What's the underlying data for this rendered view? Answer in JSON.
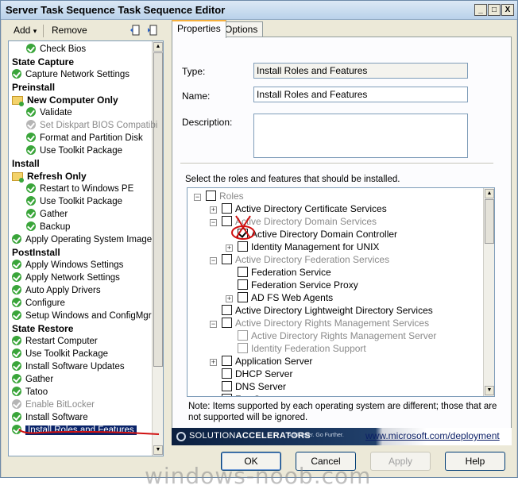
{
  "window": {
    "title": "Server Task Sequence Task Sequence Editor",
    "min": "_",
    "max": "□",
    "close": "X"
  },
  "toolbar": {
    "add_label": "Add",
    "add_caret": "▾",
    "remove_label": "Remove"
  },
  "steps": [
    {
      "label": "Check Bios",
      "kind": "step",
      "indent": 1
    },
    {
      "label": "State Capture",
      "kind": "group",
      "indent": 0
    },
    {
      "label": "Capture Network Settings",
      "kind": "step",
      "indent": 0
    },
    {
      "label": "Preinstall",
      "kind": "group",
      "indent": 0
    },
    {
      "label": "New Computer Only",
      "kind": "folder",
      "indent": 0
    },
    {
      "label": "Validate",
      "kind": "step",
      "indent": 1
    },
    {
      "label": "Set Diskpart BIOS Compatibi",
      "kind": "disabled",
      "indent": 1
    },
    {
      "label": "Format and Partition Disk",
      "kind": "step",
      "indent": 1
    },
    {
      "label": "Use Toolkit Package",
      "kind": "step",
      "indent": 1
    },
    {
      "label": "Install",
      "kind": "group",
      "indent": 0
    },
    {
      "label": "Refresh Only",
      "kind": "folder",
      "indent": 0
    },
    {
      "label": "Restart to Windows PE",
      "kind": "step",
      "indent": 1
    },
    {
      "label": "Use Toolkit Package",
      "kind": "step",
      "indent": 1
    },
    {
      "label": "Gather",
      "kind": "step",
      "indent": 1
    },
    {
      "label": "Backup",
      "kind": "step",
      "indent": 1
    },
    {
      "label": "Apply Operating System Image",
      "kind": "step",
      "indent": 0
    },
    {
      "label": "PostInstall",
      "kind": "group",
      "indent": 0
    },
    {
      "label": "Apply Windows Settings",
      "kind": "step",
      "indent": 0
    },
    {
      "label": "Apply Network Settings",
      "kind": "step",
      "indent": 0
    },
    {
      "label": "Auto Apply Drivers",
      "kind": "step",
      "indent": 0
    },
    {
      "label": "Configure",
      "kind": "step",
      "indent": 0
    },
    {
      "label": "Setup Windows and ConfigMgr",
      "kind": "step",
      "indent": 0
    },
    {
      "label": "State Restore",
      "kind": "group",
      "indent": 0
    },
    {
      "label": "Restart Computer",
      "kind": "step",
      "indent": 0
    },
    {
      "label": "Use Toolkit Package",
      "kind": "step",
      "indent": 0
    },
    {
      "label": "Install Software Updates",
      "kind": "step",
      "indent": 0
    },
    {
      "label": "Gather",
      "kind": "step",
      "indent": 0
    },
    {
      "label": "Tatoo",
      "kind": "step",
      "indent": 0
    },
    {
      "label": "Enable BitLocker",
      "kind": "disabled",
      "indent": 0
    },
    {
      "label": "Install Software",
      "kind": "step",
      "indent": 0
    },
    {
      "label": "Install Roles and Features",
      "kind": "selected",
      "indent": 0
    }
  ],
  "tabs": {
    "properties": "Properties",
    "options": "Options"
  },
  "form": {
    "type_label": "Type:",
    "type_value": "Install Roles and Features",
    "name_label": "Name:",
    "name_value": "Install Roles and Features",
    "description_label": "Description:",
    "description_value": "",
    "roles_prompt": "Select the roles and features that should be installed."
  },
  "roles": [
    {
      "label": "Roles",
      "level": 0,
      "expander": "−",
      "checked": false,
      "gray": true
    },
    {
      "label": "Active Directory Certificate Services",
      "level": 1,
      "expander": "+",
      "checked": false,
      "gray": false
    },
    {
      "label": "Active Directory Domain Services",
      "level": 1,
      "expander": "−",
      "checked": false,
      "gray": true
    },
    {
      "label": "Active Directory Domain Controller",
      "level": 2,
      "expander": "",
      "checked": true,
      "gray": false
    },
    {
      "label": "Identity Management for UNIX",
      "level": 2,
      "expander": "+",
      "checked": false,
      "gray": false
    },
    {
      "label": "Active Directory Federation Services",
      "level": 1,
      "expander": "−",
      "checked": false,
      "gray": true
    },
    {
      "label": "Federation Service",
      "level": 2,
      "expander": "",
      "checked": false,
      "gray": false
    },
    {
      "label": "Federation Service Proxy",
      "level": 2,
      "expander": "",
      "checked": false,
      "gray": false
    },
    {
      "label": "AD FS Web Agents",
      "level": 2,
      "expander": "+",
      "checked": false,
      "gray": false
    },
    {
      "label": "Active Directory Lightweight Directory Services",
      "level": 1,
      "expander": "",
      "checked": false,
      "gray": false
    },
    {
      "label": "Active Directory Rights Management Services",
      "level": 1,
      "expander": "−",
      "checked": false,
      "gray": true
    },
    {
      "label": "Active Directory Rights Management Server",
      "level": 2,
      "expander": "",
      "checked": false,
      "gray": true
    },
    {
      "label": "Identity Federation Support",
      "level": 2,
      "expander": "",
      "checked": false,
      "gray": true
    },
    {
      "label": "Application Server",
      "level": 1,
      "expander": "+",
      "checked": false,
      "gray": false
    },
    {
      "label": "DHCP Server",
      "level": 1,
      "expander": "",
      "checked": false,
      "gray": false
    },
    {
      "label": "DNS Server",
      "level": 1,
      "expander": "",
      "checked": false,
      "gray": false
    },
    {
      "label": "Fax Server",
      "level": 1,
      "expander": "",
      "checked": false,
      "gray": false
    }
  ],
  "note": "Note:  Items supported by each operating system are different; those that are not supported will be ignored.",
  "banner": {
    "brand_a": "SOLUTION",
    "brand_b": "ACCELERATORS",
    "tagline": "Act Faster. Go Further.",
    "link": "www.microsoft.com/deployment"
  },
  "buttons": {
    "ok": "OK",
    "cancel": "Cancel",
    "apply": "Apply",
    "help": "Help"
  },
  "watermark": "windows-noob.com",
  "colors": {
    "selection": "#0a246a",
    "step_ok": "#3aa53a",
    "annotation_red": "#d01010"
  }
}
